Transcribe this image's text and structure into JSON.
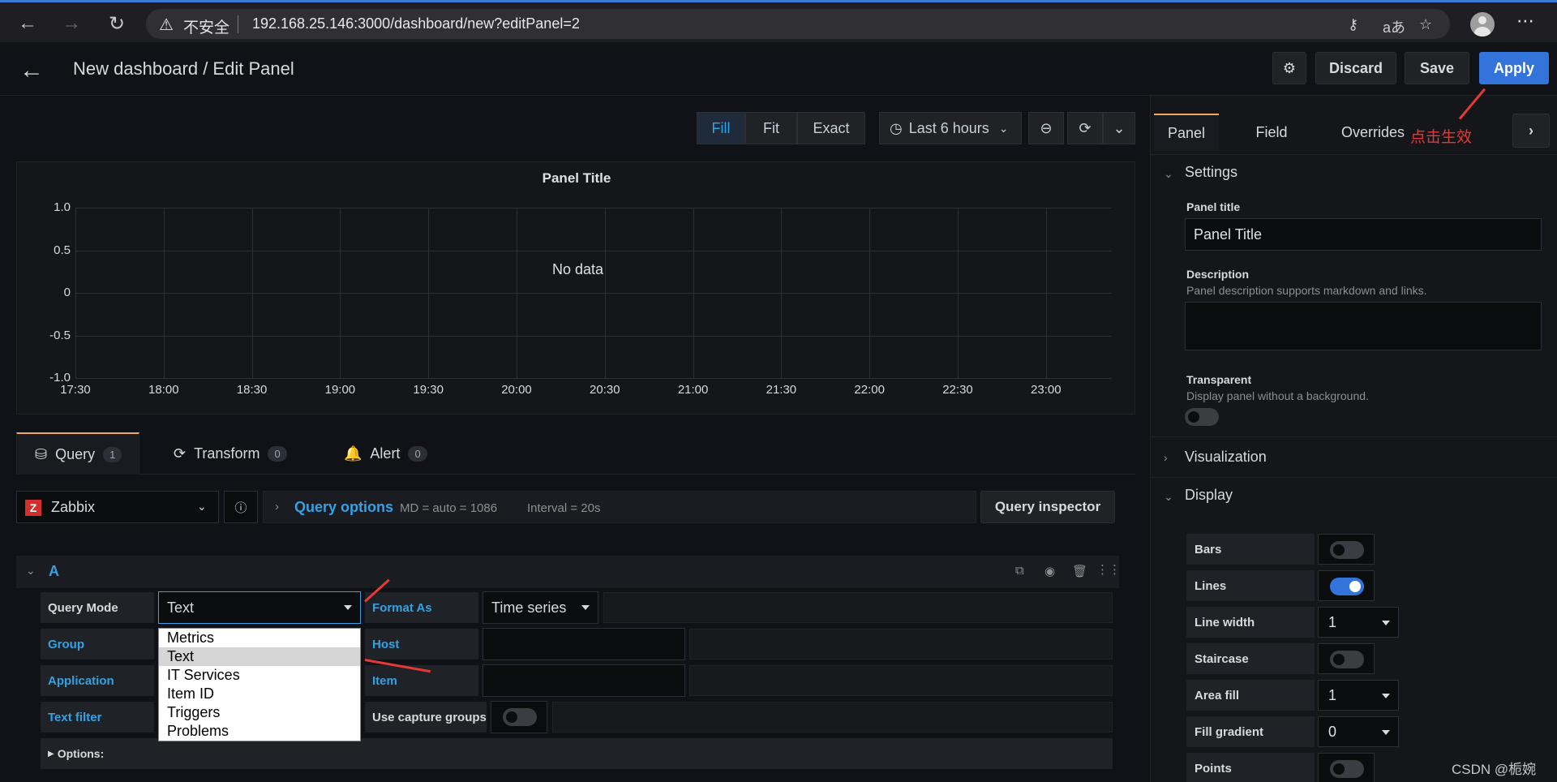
{
  "browser": {
    "warning": "不安全",
    "url": "192.168.25.146:3000/dashboard/new?editPanel=2"
  },
  "header": {
    "title": "New dashboard / Edit Panel",
    "discard": "Discard",
    "save": "Save",
    "apply": "Apply"
  },
  "viewbar": {
    "fill": "Fill",
    "fit": "Fit",
    "exact": "Exact",
    "time_range": "Last 6 hours"
  },
  "chart_data": {
    "type": "line",
    "title": "Panel Title",
    "message": "No data",
    "y_ticks": [
      "1.0",
      "0.5",
      "0",
      "-0.5",
      "-1.0"
    ],
    "x_ticks": [
      "17:30",
      "18:00",
      "18:30",
      "19:00",
      "19:30",
      "20:00",
      "20:30",
      "21:00",
      "21:30",
      "22:00",
      "22:30",
      "23:00"
    ],
    "ylim": [
      -1.0,
      1.0
    ],
    "series": []
  },
  "query_tabs": [
    {
      "label": "Query",
      "count": "1"
    },
    {
      "label": "Transform",
      "count": "0"
    },
    {
      "label": "Alert",
      "count": "0"
    }
  ],
  "datasource": {
    "name": "Zabbix",
    "query_options": "Query options",
    "md": "MD = auto = 1086",
    "interval": "Interval = 20s",
    "inspector": "Query inspector"
  },
  "query": {
    "ref": "A",
    "labels": {
      "query_mode": "Query Mode",
      "group": "Group",
      "application": "Application",
      "text_filter": "Text filter",
      "format_as": "Format As",
      "host": "Host",
      "item": "Item",
      "capture": "Use capture groups",
      "options": "Options:"
    },
    "query_mode_value": "Text",
    "format_value": "Time series",
    "mode_options": [
      "Metrics",
      "Text",
      "IT Services",
      "Item ID",
      "Triggers",
      "Problems"
    ]
  },
  "right_panel": {
    "tabs": [
      "Panel",
      "Field",
      "Overrides"
    ],
    "note": "点击生效",
    "settings": "Settings",
    "panel_title_label": "Panel title",
    "panel_title_value": "Panel Title",
    "description_label": "Description",
    "description_help": "Panel description supports markdown and links.",
    "transparent_label": "Transparent",
    "transparent_help": "Display panel without a background.",
    "visualization": "Visualization",
    "display": "Display",
    "display_rows": [
      {
        "label": "Bars",
        "kind": "toggle",
        "on": false
      },
      {
        "label": "Lines",
        "kind": "toggle",
        "on": true
      },
      {
        "label": "Line width",
        "kind": "select",
        "value": "1"
      },
      {
        "label": "Staircase",
        "kind": "toggle",
        "on": false
      },
      {
        "label": "Area fill",
        "kind": "select",
        "value": "1"
      },
      {
        "label": "Fill gradient",
        "kind": "select",
        "value": "0"
      },
      {
        "label": "Points",
        "kind": "toggle",
        "on": false
      }
    ]
  },
  "watermark": "CSDN @栀婉"
}
